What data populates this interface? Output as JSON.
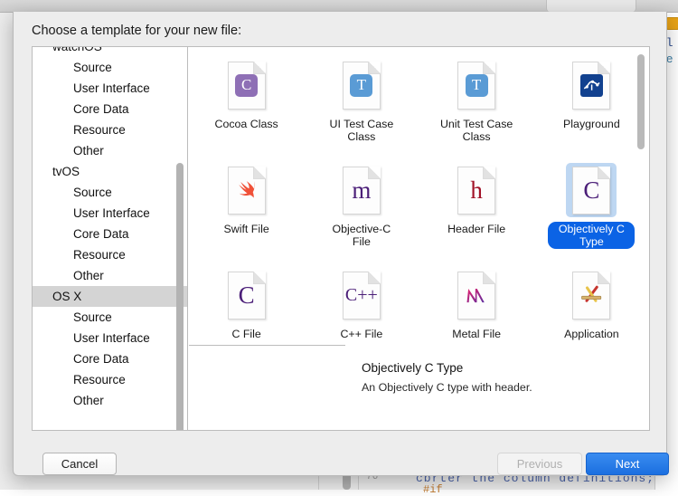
{
  "background": {
    "code_line_right_1": "ol",
    "code_line_right_2": "ie",
    "code_bottom": "cbrter the column definitions;",
    "code_bottom_2": "#if",
    "gutter_number": "76"
  },
  "sheet": {
    "title": "Choose a template for your new file:"
  },
  "sidebar": {
    "items": [
      {
        "label": "watchOS",
        "type": "group",
        "selected": false
      },
      {
        "label": "Source",
        "type": "child",
        "selected": false
      },
      {
        "label": "User Interface",
        "type": "child",
        "selected": false
      },
      {
        "label": "Core Data",
        "type": "child",
        "selected": false
      },
      {
        "label": "Resource",
        "type": "child",
        "selected": false
      },
      {
        "label": "Other",
        "type": "child",
        "selected": false
      },
      {
        "label": "tvOS",
        "type": "group",
        "selected": false
      },
      {
        "label": "Source",
        "type": "child",
        "selected": false
      },
      {
        "label": "User Interface",
        "type": "child",
        "selected": false
      },
      {
        "label": "Core Data",
        "type": "child",
        "selected": false
      },
      {
        "label": "Resource",
        "type": "child",
        "selected": false
      },
      {
        "label": "Other",
        "type": "child",
        "selected": false
      },
      {
        "label": "OS X",
        "type": "group",
        "selected": true
      },
      {
        "label": "Source",
        "type": "child",
        "selected": false
      },
      {
        "label": "User Interface",
        "type": "child",
        "selected": false
      },
      {
        "label": "Core Data",
        "type": "child",
        "selected": false
      },
      {
        "label": "Resource",
        "type": "child",
        "selected": false
      },
      {
        "label": "Other",
        "type": "child",
        "selected": false
      }
    ]
  },
  "templates": [
    {
      "label": "Cocoa Class",
      "icon": "cocoa-class-icon",
      "glyph": "C",
      "style": "chip",
      "color": "#8e6fb5",
      "selected": false
    },
    {
      "label": "UI Test Case Class",
      "icon": "ui-test-case-class-icon",
      "glyph": "T",
      "style": "chip",
      "color": "#5a9bd5",
      "selected": false
    },
    {
      "label": "Unit Test Case Class",
      "icon": "unit-test-case-class-icon",
      "glyph": "T",
      "style": "chip",
      "color": "#5a9bd5",
      "selected": false
    },
    {
      "label": "Playground",
      "icon": "playground-icon",
      "glyph": "",
      "style": "playground",
      "color": "#12418f",
      "selected": false
    },
    {
      "label": "Swift File",
      "icon": "swift-file-icon",
      "glyph": "",
      "style": "swift",
      "color": "#f05138",
      "selected": false
    },
    {
      "label": "Objective-C File",
      "icon": "objective-c-file-icon",
      "glyph": "m",
      "style": "letter",
      "color": "#4b1e78",
      "selected": false
    },
    {
      "label": "Header File",
      "icon": "header-file-icon",
      "glyph": "h",
      "style": "letter",
      "color": "#a11227",
      "selected": false
    },
    {
      "label": "Objectively C Type",
      "icon": "objectively-c-type-icon",
      "glyph": "C",
      "style": "letter",
      "color": "#4b1e78",
      "selected": true
    },
    {
      "label": "C File",
      "icon": "c-file-icon",
      "glyph": "C",
      "style": "letter",
      "color": "#4b1e78",
      "selected": false
    },
    {
      "label": "C++ File",
      "icon": "cpp-file-icon",
      "glyph": "C++",
      "style": "letter-small",
      "color": "#4b1e78",
      "selected": false
    },
    {
      "label": "Metal File",
      "icon": "metal-file-icon",
      "glyph": "M",
      "style": "metal",
      "color": "#d61f6e",
      "selected": false
    },
    {
      "label": "Application",
      "icon": "application-icon",
      "glyph": "",
      "style": "application",
      "color": "#d4a017",
      "selected": false
    }
  ],
  "description": {
    "title": "Objectively C Type",
    "body": "An Objectively C type with header."
  },
  "footer": {
    "cancel_label": "Cancel",
    "previous_label": "Previous",
    "next_label": "Next",
    "next_color": "#1b6fe0"
  }
}
